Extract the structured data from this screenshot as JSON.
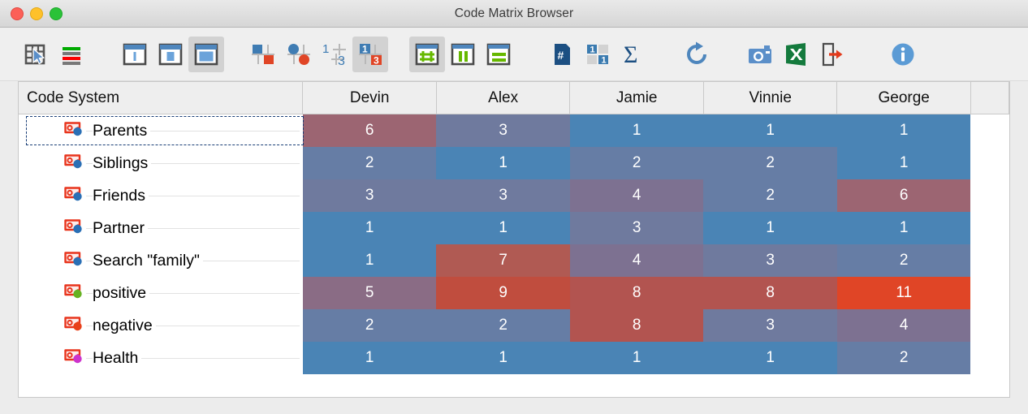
{
  "window": {
    "title": "Code Matrix Browser",
    "controls": [
      "close",
      "minimize",
      "maximize"
    ]
  },
  "toolbar": {
    "groups": [
      {
        "items": [
          {
            "name": "select-matrix-icon",
            "label": "Select table cells",
            "selected": false
          },
          {
            "name": "legend-bars-icon",
            "label": "Show legend",
            "selected": false
          }
        ]
      },
      {
        "items": [
          {
            "name": "size-small-icon",
            "label": "Small symbol size",
            "selected": false
          },
          {
            "name": "size-medium-icon",
            "label": "Medium symbol size",
            "selected": false
          },
          {
            "name": "size-large-icon",
            "label": "Large symbol size",
            "selected": true
          }
        ]
      },
      {
        "items": [
          {
            "name": "square-symbol-icon",
            "label": "Square symbols",
            "selected": false
          },
          {
            "name": "circle-symbol-icon",
            "label": "Circle symbols",
            "selected": false
          },
          {
            "name": "number-symbol-icon",
            "label": "Numbers only",
            "selected": false
          },
          {
            "name": "number-in-square-icon",
            "label": "Numbers in squares",
            "selected": true
          }
        ]
      },
      {
        "items": [
          {
            "name": "grid-pattern-icon",
            "label": "Grid colouring",
            "selected": true
          },
          {
            "name": "column-pattern-icon",
            "label": "Column colouring",
            "selected": false
          },
          {
            "name": "row-pattern-icon",
            "label": "Row colouring",
            "selected": false
          }
        ]
      },
      {
        "items": [
          {
            "name": "document-count-icon",
            "label": "Count documents",
            "selected": false
          },
          {
            "name": "binarize-icon",
            "label": "Binarize counts",
            "selected": false
          },
          {
            "name": "sum-sigma-icon",
            "label": "Show sums",
            "selected": false
          }
        ]
      },
      {
        "items": [
          {
            "name": "refresh-icon",
            "label": "Refresh",
            "selected": false
          }
        ]
      },
      {
        "items": [
          {
            "name": "camera-snapshot-icon",
            "label": "Copy as image",
            "selected": false
          },
          {
            "name": "excel-export-icon",
            "label": "Open in Excel",
            "selected": false
          },
          {
            "name": "export-file-icon",
            "label": "Export",
            "selected": false
          }
        ]
      },
      {
        "items": [
          {
            "name": "info-icon",
            "label": "Information",
            "selected": false
          }
        ]
      }
    ]
  },
  "matrix": {
    "row_header_label": "Code System",
    "columns": [
      "Devin",
      "Alex",
      "Jamie",
      "Vinnie",
      "George"
    ],
    "rows": [
      {
        "label": "Parents",
        "dot_color": "#2a6fb5",
        "selected": true,
        "values": [
          6,
          3,
          1,
          1,
          1
        ]
      },
      {
        "label": "Siblings",
        "dot_color": "#2a6fb5",
        "selected": false,
        "values": [
          2,
          1,
          2,
          2,
          1
        ]
      },
      {
        "label": "Friends",
        "dot_color": "#2a6fb5",
        "selected": false,
        "values": [
          3,
          3,
          4,
          2,
          6
        ]
      },
      {
        "label": "Partner",
        "dot_color": "#2a6fb5",
        "selected": false,
        "values": [
          1,
          1,
          3,
          1,
          1
        ]
      },
      {
        "label": "Search \"family\"",
        "dot_color": "#2a6fb5",
        "selected": false,
        "values": [
          1,
          7,
          4,
          3,
          2
        ]
      },
      {
        "label": "positive",
        "dot_color": "#66b222",
        "selected": false,
        "values": [
          5,
          9,
          8,
          8,
          11
        ]
      },
      {
        "label": "negative",
        "dot_color": "#e8401a",
        "selected": false,
        "values": [
          2,
          2,
          8,
          3,
          4
        ]
      },
      {
        "label": "Health",
        "dot_color": "#cc33cc",
        "selected": false,
        "values": [
          1,
          1,
          1,
          1,
          2
        ]
      }
    ],
    "value_colors": {
      "1": "#4a84b5",
      "2": "#667da5",
      "3": "#6f7a9e",
      "4": "#7d7191",
      "5": "#8a6c85",
      "6": "#9c6572",
      "7": "#b05a53",
      "8": "#b25450",
      "9": "#c04d3e",
      "10": "#d04a32",
      "11": "#e04526"
    },
    "scale_min": 1,
    "scale_max": 11
  },
  "colors": {
    "accent_blue": "#4a84b5",
    "accent_red": "#e04526",
    "code_icon_red": "#e8341c",
    "toolbar_bg": "#efefef",
    "header_bg": "#eeeeee"
  }
}
